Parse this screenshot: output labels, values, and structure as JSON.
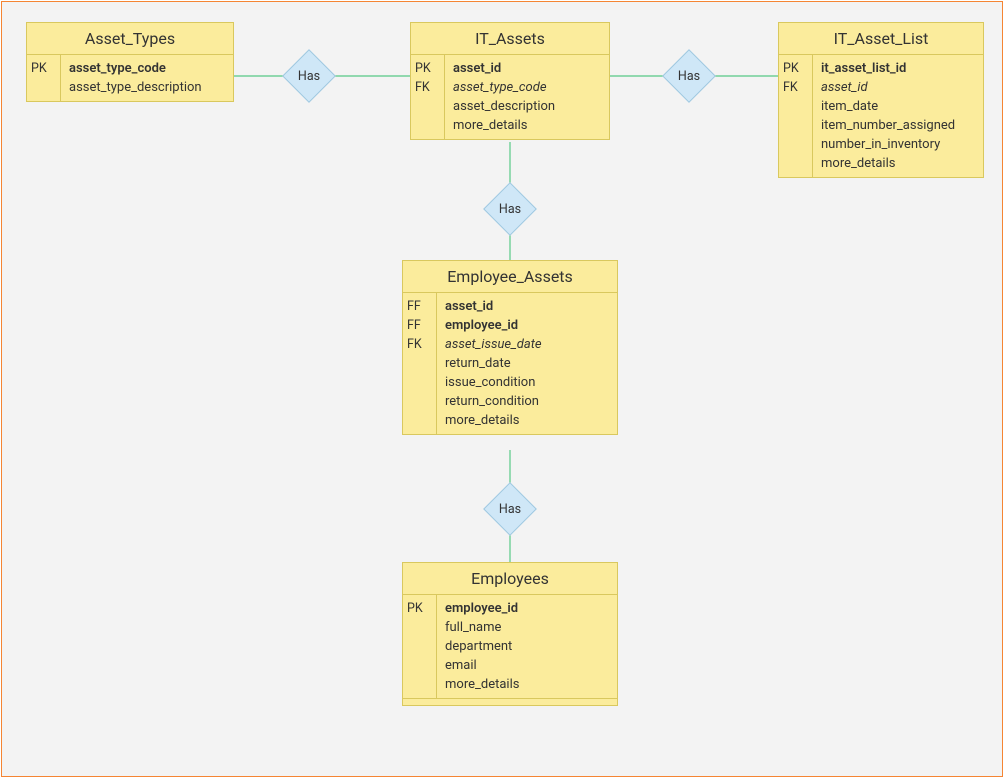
{
  "relationship_label": "Has",
  "entities": {
    "asset_types": {
      "title": "Asset_Types",
      "rows": [
        {
          "key": "PK",
          "name": "asset_type_code",
          "bold": true
        },
        {
          "key": "",
          "name": "asset_type_description"
        }
      ]
    },
    "it_assets": {
      "title": "IT_Assets",
      "rows": [
        {
          "key": "PK",
          "name": "asset_id",
          "bold": true
        },
        {
          "key": "FK",
          "name": "asset_type_code",
          "italic": true
        },
        {
          "key": "",
          "name": "asset_description"
        },
        {
          "key": "",
          "name": "more_details"
        }
      ]
    },
    "it_asset_list": {
      "title": "IT_Asset_List",
      "rows": [
        {
          "key": "PK",
          "name": "it_asset_list_id",
          "bold": true
        },
        {
          "key": "FK",
          "name": "asset_id",
          "italic": true
        },
        {
          "key": "",
          "name": "item_date"
        },
        {
          "key": "",
          "name": "item_number_assigned"
        },
        {
          "key": "",
          "name": "number_in_inventory"
        },
        {
          "key": "",
          "name": "more_details"
        }
      ]
    },
    "employee_assets": {
      "title": "Employee_Assets",
      "rows": [
        {
          "key": "FF",
          "name": "asset_id",
          "bold": true
        },
        {
          "key": "FF",
          "name": "employee_id",
          "bold": true
        },
        {
          "key": "FK",
          "name": "asset_issue_date",
          "italic": true
        },
        {
          "key": "",
          "name": "return_date"
        },
        {
          "key": "",
          "name": "issue_condition"
        },
        {
          "key": "",
          "name": "return_condition"
        },
        {
          "key": "",
          "name": "more_details"
        }
      ]
    },
    "employees": {
      "title": "Employees",
      "rows": [
        {
          "key": "PK",
          "name": "employee_id",
          "bold": true
        },
        {
          "key": "",
          "name": "full_name"
        },
        {
          "key": "",
          "name": "department"
        },
        {
          "key": "",
          "name": "email"
        },
        {
          "key": "",
          "name": "more_details"
        }
      ]
    }
  }
}
